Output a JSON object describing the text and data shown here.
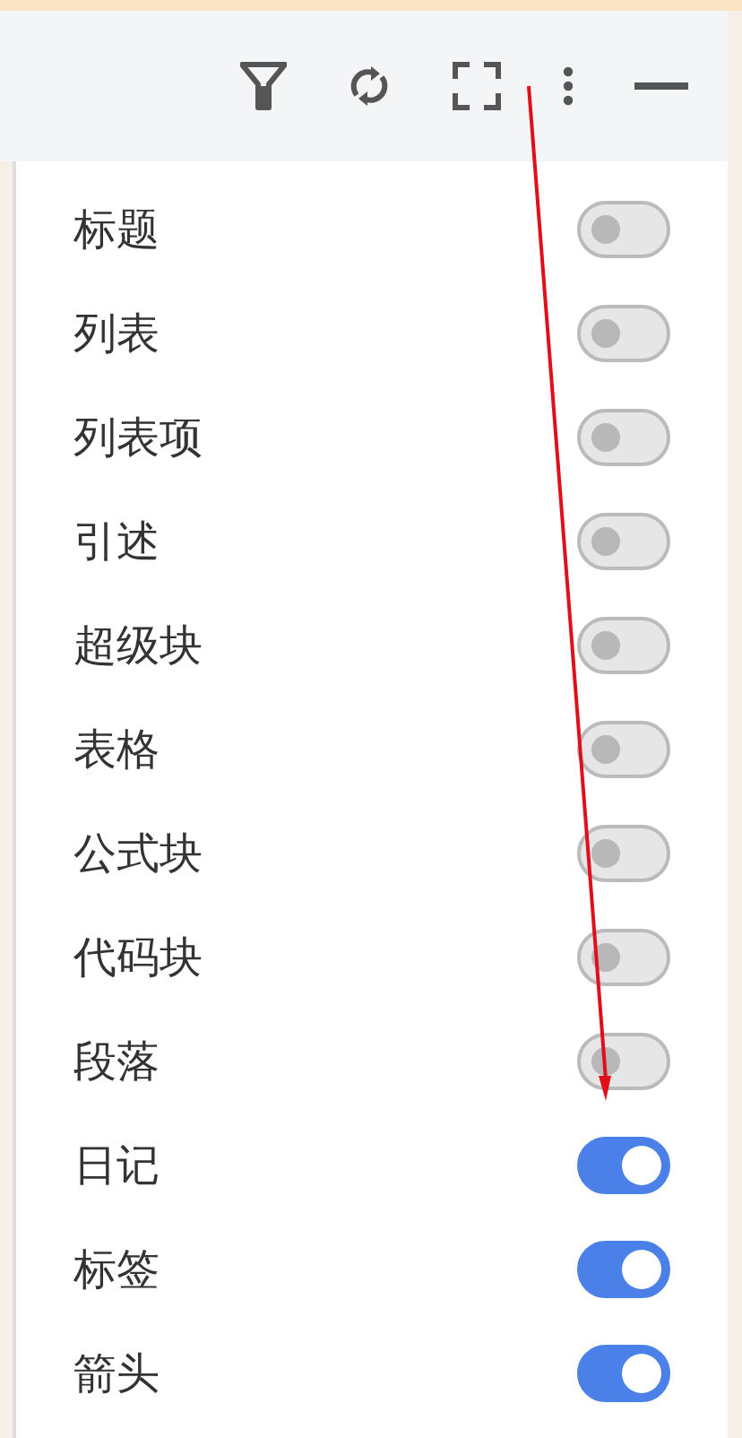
{
  "toolbar": {
    "buttons": [
      {
        "kind": "filter"
      },
      {
        "kind": "refresh"
      },
      {
        "kind": "fullscreen"
      },
      {
        "kind": "more"
      },
      {
        "kind": "minimize"
      }
    ]
  },
  "settings": [
    {
      "label": "标题",
      "on": false
    },
    {
      "label": "列表",
      "on": false
    },
    {
      "label": "列表项",
      "on": false
    },
    {
      "label": "引述",
      "on": false
    },
    {
      "label": "超级块",
      "on": false
    },
    {
      "label": "表格",
      "on": false
    },
    {
      "label": "公式块",
      "on": false
    },
    {
      "label": "代码块",
      "on": false
    },
    {
      "label": "段落",
      "on": false
    },
    {
      "label": "日记",
      "on": true
    },
    {
      "label": "标签",
      "on": true
    },
    {
      "label": "箭头",
      "on": true
    }
  ]
}
